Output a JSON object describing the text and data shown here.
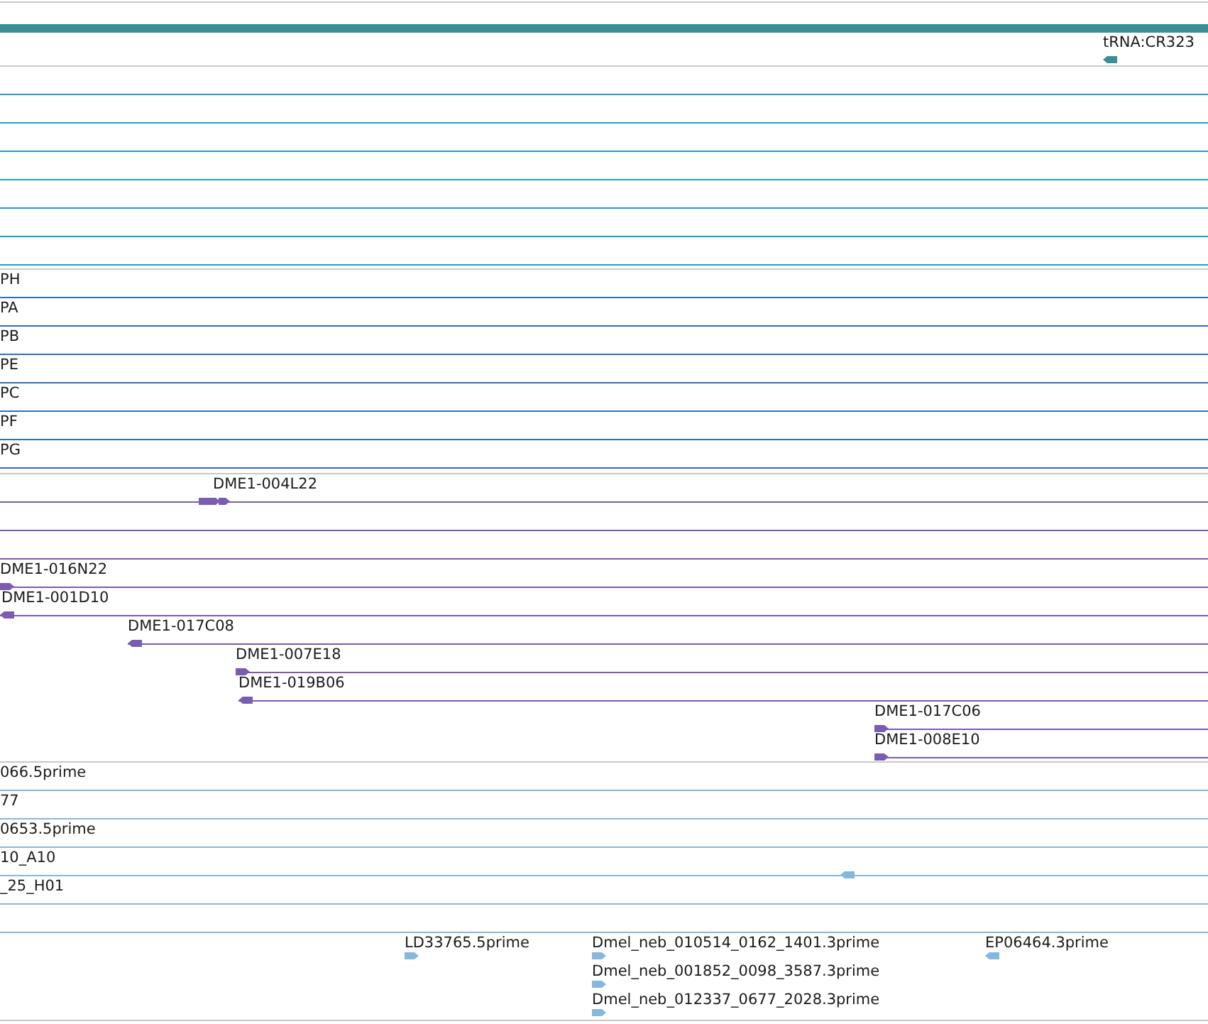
{
  "tracks": [
    {
      "color": "#3a8f96",
      "features": [
        {
          "label": "tRNA:CR323",
          "reverse": true
        }
      ]
    },
    {
      "color": "#1aa0c8"
    },
    {
      "color": "#2f6fc0",
      "features": [
        {
          "label": "PH"
        },
        {
          "label": "PA"
        },
        {
          "label": "PB"
        },
        {
          "label": "PE"
        },
        {
          "label": "PC"
        },
        {
          "label": "PF"
        },
        {
          "label": "PG"
        }
      ]
    },
    {
      "color": "#7a5cb0",
      "features": [
        {
          "label": "DME1-004L22",
          "reverse": false
        },
        {
          "label": "DME1-016N22",
          "reverse": false
        },
        {
          "label": "DME1-001D10",
          "reverse": true
        },
        {
          "label": "DME1-017C08",
          "reverse": true
        },
        {
          "label": "DME1-007E18",
          "reverse": false
        },
        {
          "label": "DME1-019B06",
          "reverse": true
        },
        {
          "label": "DME1-017C06",
          "reverse": false
        },
        {
          "label": "DME1-008E10",
          "reverse": false
        }
      ]
    },
    {
      "color": "#86b8dc",
      "features": [
        {
          "label": "066.5prime"
        },
        {
          "label": "77"
        },
        {
          "label": "0653.5prime"
        },
        {
          "label": "10_A10"
        },
        {
          "reverse": true
        },
        {
          "label": "_25_H01"
        },
        {
          "label": "LD33765.5prime",
          "reverse": false
        },
        {
          "label": "Dmel_neb_010514_0162_1401.3prime",
          "reverse": false
        },
        {
          "label": "EP06464.3prime",
          "reverse": true
        },
        {
          "label": "Dmel_neb_001852_0098_3587.3prime",
          "reverse": false
        },
        {
          "label": "Dmel_neb_012337_0677_2028.3prime",
          "reverse": false
        }
      ]
    }
  ]
}
